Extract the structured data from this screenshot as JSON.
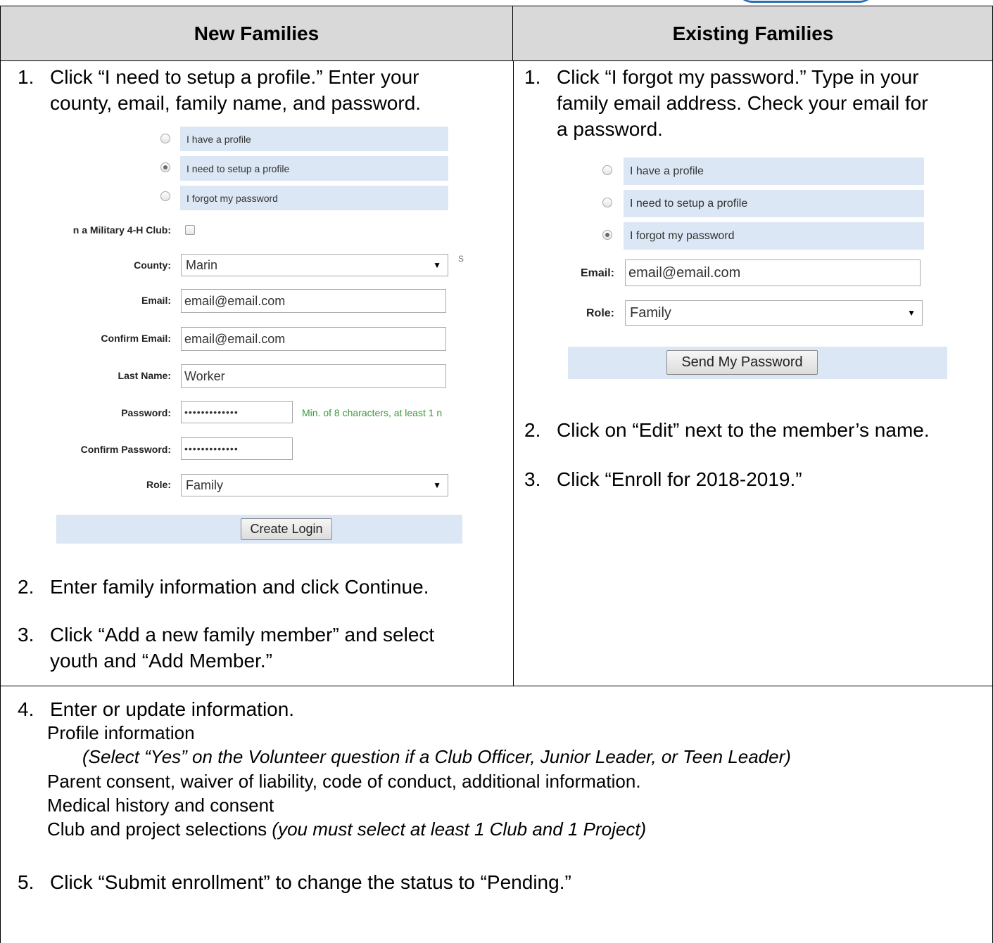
{
  "headers": {
    "left": "New Families",
    "right": "Existing Families"
  },
  "new_families": {
    "step1": {
      "num": "1.",
      "line1": "Click “I need to setup a profile.” Enter your",
      "line2": "county, email, family name, and password."
    },
    "form": {
      "options": [
        "I have a profile",
        "I need to setup a profile",
        "I forgot my password"
      ],
      "selected_option": 1,
      "military_label": "n a Military 4-H Club:",
      "county_label": "County:",
      "county_value": "Marin",
      "stray_char": "S",
      "email_label": "Email:",
      "email_value": "email@email.com",
      "confirm_email_label": "Confirm Email:",
      "confirm_email_value": "email@email.com",
      "last_name_label": "Last Name:",
      "last_name_value": "Worker",
      "password_label": "Password:",
      "password_value": "•••••••••••••",
      "password_hint": "Min. of 8 characters, at least 1 n",
      "confirm_password_label": "Confirm Password:",
      "confirm_password_value": "•••••••••••••",
      "role_label": "Role:",
      "role_value": "Family",
      "create_button": "Create Login"
    },
    "step2": {
      "num": "2.",
      "text": "Enter family information and click Continue."
    },
    "step3": {
      "num": "3.",
      "line1": "Click “Add a new family member” and select",
      "line2": "youth and “Add Member.”"
    }
  },
  "existing_families": {
    "step1": {
      "num": "1.",
      "line1": "Click “I forgot my password.” Type in your",
      "line2": "family email address. Check your email for",
      "line3": "a password."
    },
    "form": {
      "options": [
        "I have a profile",
        "I need to setup a profile",
        "I forgot my password"
      ],
      "selected_option": 2,
      "email_label": "Email:",
      "email_value": "email@email.com",
      "role_label": "Role:",
      "role_value": "Family",
      "send_button": "Send My Password"
    },
    "step2": {
      "num": "2.",
      "text": "Click on “Edit” next to the member’s name."
    },
    "step3": {
      "num": "3.",
      "text": "Click “Enroll for 2018-2019.”"
    }
  },
  "shared": {
    "step4": {
      "num": "4.",
      "title": "Enter or update information.",
      "profile": "Profile information",
      "volunteer_note": "(Select “Yes” on the Volunteer question if a Club Officer, Junior Leader, or Teen Leader)",
      "consent": "Parent consent, waiver of liability, code of conduct, additional information.",
      "medical": "Medical history and consent",
      "club_text": "Club and project selections ",
      "club_note": "(you must select at least 1 Club and 1 Project)"
    },
    "step5": {
      "num": "5.",
      "text": "Click “Submit enrollment” to change the status to “Pending.”"
    }
  }
}
